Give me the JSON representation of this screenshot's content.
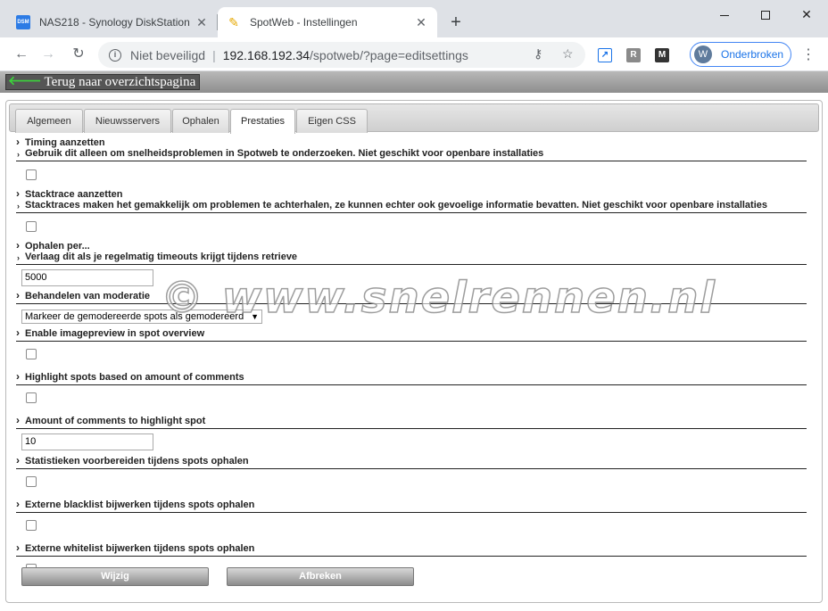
{
  "browser": {
    "tabs": [
      {
        "title": "NAS218 - Synology DiskStation",
        "favicon": "dsm-icon",
        "favicon_text": "DSM",
        "active": false
      },
      {
        "title": "SpotWeb - Instellingen",
        "favicon": "pen-icon",
        "active": true
      }
    ],
    "security_label": "Niet beveiligd",
    "url_host": "192.168.192.34",
    "url_path": "/spotweb/?page=editsettings",
    "extensions": [
      "↗",
      "R",
      "M"
    ],
    "profile": {
      "initial": "W",
      "label": "Onderbroken"
    }
  },
  "page": {
    "back_link": "Terug naar overzichtspagina",
    "tabs": [
      {
        "label": "Algemeen",
        "selected": false
      },
      {
        "label": "Nieuwsservers",
        "selected": false
      },
      {
        "label": "Ophalen",
        "selected": false
      },
      {
        "label": "Prestaties",
        "selected": true
      },
      {
        "label": "Eigen CSS",
        "selected": false
      }
    ],
    "settings": [
      {
        "title": "Timing aanzetten",
        "description": "Gebruik dit alleen om snelheidsproblemen in Spotweb te onderzoeken. Niet geschikt voor openbare installaties",
        "control": "checkbox",
        "checked": false
      },
      {
        "title": "Stacktrace aanzetten",
        "description": "Stacktraces maken het gemakkelijk om problemen te achterhalen, ze kunnen echter ook gevoelige informatie bevatten. Niet geschikt voor openbare installaties",
        "control": "checkbox",
        "checked": false
      },
      {
        "title": "Ophalen per...",
        "description": "Verlaag dit als je regelmatig timeouts krijgt tijdens retrieve",
        "control": "text",
        "value": "5000"
      },
      {
        "title": "Behandelen van moderatie",
        "control": "select",
        "value": "Markeer de gemodereerde spots als gemodereerd"
      },
      {
        "title": "Enable imagepreview in spot overview",
        "control": "checkbox",
        "checked": false
      },
      {
        "title": "Highlight spots based on amount of comments",
        "control": "checkbox",
        "checked": false
      },
      {
        "title": "Amount of comments to highlight spot",
        "control": "text",
        "value": "10"
      },
      {
        "title": "Statistieken voorbereiden tijdens spots ophalen",
        "control": "checkbox",
        "checked": false
      },
      {
        "title": "Externe blacklist bijwerken tijdens spots ophalen",
        "control": "checkbox",
        "checked": false
      },
      {
        "title": "Externe whitelist bijwerken tijdens spots ophalen",
        "control": "checkbox",
        "checked": false
      }
    ],
    "save_label": "Wijzig",
    "cancel_label": "Afbreken",
    "watermark": "© www.snelrennen.nl"
  }
}
